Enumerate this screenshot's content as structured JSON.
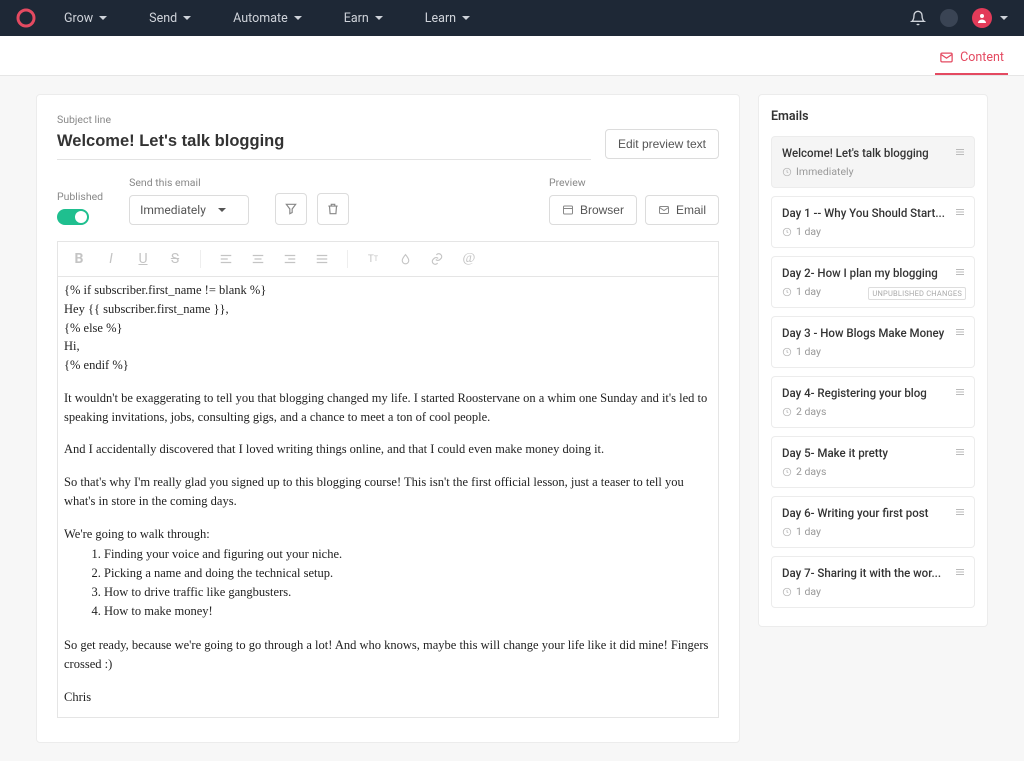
{
  "nav": {
    "items": [
      "Grow",
      "Send",
      "Automate",
      "Earn",
      "Learn"
    ]
  },
  "subbar": {
    "content_tab": "Content"
  },
  "editor": {
    "subject_label": "Subject line",
    "subject": "Welcome! Let's talk blogging",
    "edit_preview_text": "Edit preview text",
    "published_label": "Published",
    "send_label": "Send this email",
    "send_timing": "Immediately",
    "preview_label": "Preview",
    "browser_btn": "Browser",
    "email_btn": "Email",
    "body": {
      "l1": "{% if subscriber.first_name != blank %}",
      "l2": "Hey {{ subscriber.first_name }},",
      "l3": "{% else %}",
      "l4": "Hi,",
      "l5": "{% endif %}",
      "p1": "It wouldn't be exaggerating to tell you that blogging changed my life. I started Roostervane on a whim one Sunday and it's led to speaking invitations, jobs, consulting gigs, and a chance to meet a ton of cool people.",
      "p2": "And I accidentally discovered that I loved writing things online, and that I could even make money doing it.",
      "p3": "So that's why I'm really glad you signed up to this blogging course! This isn't the first official lesson, just a teaser to tell you what's in store in the coming days.",
      "p4": "We're going to walk through:",
      "li1": "Finding your voice and figuring out your niche.",
      "li2": "Picking a name and doing the technical setup.",
      "li3": "How to drive traffic like gangbusters.",
      "li4": "How to make money!",
      "p5": "So get ready, because we're going to go through a lot! And who knows, maybe this will change your life like it did mine! Fingers crossed :)",
      "sign": "Chris"
    }
  },
  "sidebar": {
    "title": "Emails",
    "unpublished_badge": "UNPUBLISHED CHANGES",
    "items": [
      {
        "title": "Welcome! Let's talk blogging",
        "delay": "Immediately",
        "active": true,
        "badge": false
      },
      {
        "title": "Day 1 -- Why You Should Start...",
        "delay": "1 day",
        "active": false,
        "badge": false
      },
      {
        "title": "Day 2- How I plan my blogging",
        "delay": "1 day",
        "active": false,
        "badge": true
      },
      {
        "title": "Day 3 - How Blogs Make Money",
        "delay": "1 day",
        "active": false,
        "badge": false
      },
      {
        "title": "Day 4- Registering your blog",
        "delay": "2 days",
        "active": false,
        "badge": false
      },
      {
        "title": "Day 5- Make it pretty",
        "delay": "2 days",
        "active": false,
        "badge": false
      },
      {
        "title": "Day 6- Writing your first post",
        "delay": "1 day",
        "active": false,
        "badge": false
      },
      {
        "title": "Day 7- Sharing it with the wor...",
        "delay": "1 day",
        "active": false,
        "badge": false
      }
    ]
  }
}
